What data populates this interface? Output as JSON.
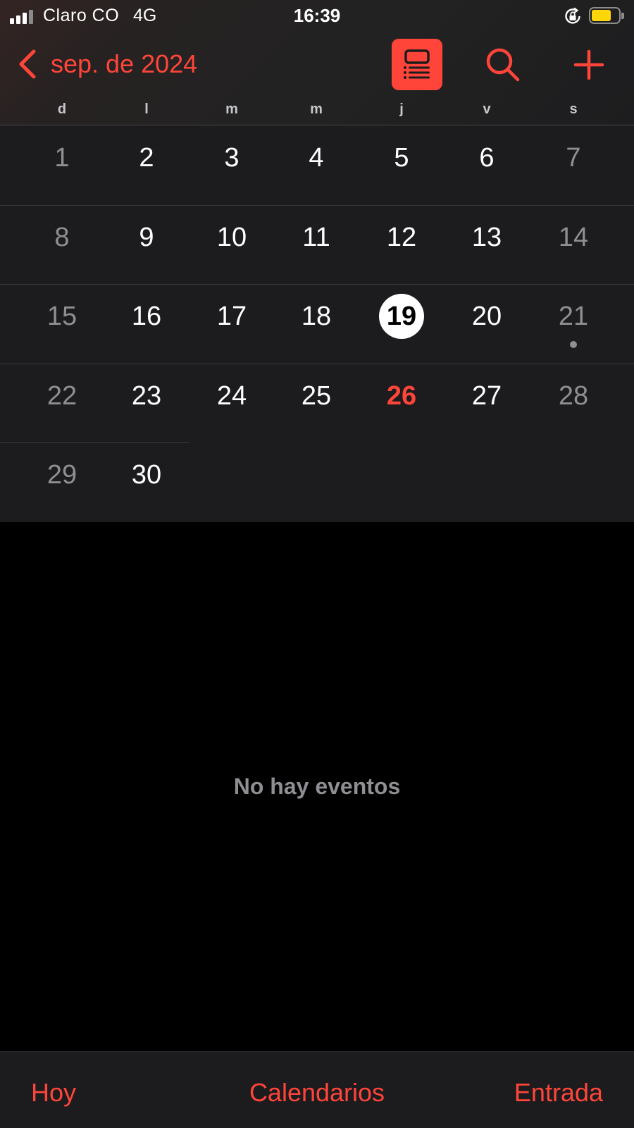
{
  "status_bar": {
    "carrier": "Claro CO",
    "network": "4G",
    "time": "16:39",
    "signal_bars": 3,
    "battery_color": "#ffd60a",
    "icons": [
      "signal-icon",
      "orientation-lock-icon",
      "battery-icon"
    ]
  },
  "nav": {
    "month_title": "sep. de 2024",
    "back_icon": "chevron-left-icon",
    "list_view_icon": "list-view-icon",
    "search_icon": "search-icon",
    "add_icon": "plus-icon"
  },
  "weekdays": [
    "d",
    "l",
    "m",
    "m",
    "j",
    "v",
    "s"
  ],
  "calendar": {
    "days": [
      {
        "day": "1"
      },
      {
        "day": "2"
      },
      {
        "day": "3"
      },
      {
        "day": "4"
      },
      {
        "day": "5"
      },
      {
        "day": "6"
      },
      {
        "day": "7"
      },
      {
        "day": "8"
      },
      {
        "day": "9"
      },
      {
        "day": "10"
      },
      {
        "day": "11"
      },
      {
        "day": "12"
      },
      {
        "day": "13"
      },
      {
        "day": "14"
      },
      {
        "day": "15"
      },
      {
        "day": "16"
      },
      {
        "day": "17"
      },
      {
        "day": "18"
      },
      {
        "day": "19",
        "selected": true
      },
      {
        "day": "20"
      },
      {
        "day": "21",
        "has_event": true
      },
      {
        "day": "22"
      },
      {
        "day": "23"
      },
      {
        "day": "24"
      },
      {
        "day": "25"
      },
      {
        "day": "26",
        "today": true
      },
      {
        "day": "27"
      },
      {
        "day": "28"
      },
      {
        "day": "29"
      },
      {
        "day": "30"
      }
    ]
  },
  "events": {
    "empty_message": "No hay eventos"
  },
  "toolbar": {
    "today_label": "Hoy",
    "calendars_label": "Calendarios",
    "inbox_label": "Entrada"
  },
  "colors": {
    "accent": "#ff453a",
    "weekend_text": "#8e8e93",
    "grid_background": "#1c1c1e"
  }
}
